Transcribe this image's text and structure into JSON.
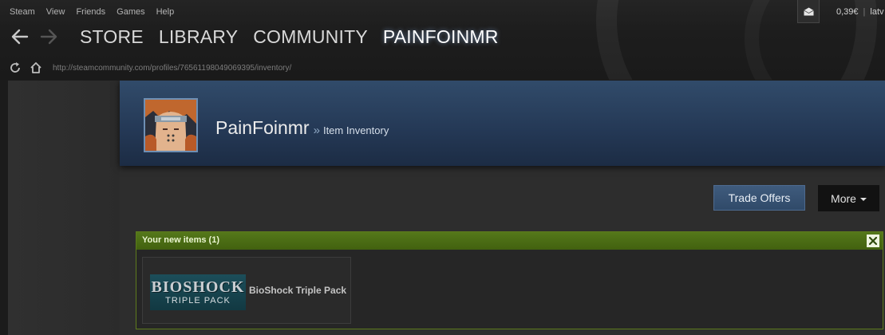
{
  "menubar": {
    "items": [
      "Steam",
      "View",
      "Friends",
      "Games",
      "Help"
    ]
  },
  "nav": {
    "tabs": [
      "STORE",
      "LIBRARY",
      "COMMUNITY",
      "PAINFOINMR"
    ],
    "active": "PAINFOINMR",
    "back_icon": "arrow-left-icon",
    "forward_icon": "arrow-right-icon"
  },
  "address": {
    "url": "http://steamcommunity.com/profiles/76561198049069395/inventory/",
    "refresh_icon": "refresh-icon",
    "home_icon": "home-icon"
  },
  "header_right": {
    "notification_icon": "envelope-icon",
    "wallet": "0,39€",
    "separator": "|",
    "language": "latv"
  },
  "profile": {
    "name": "PainFoinmr",
    "chevron": "»",
    "breadcrumb": "Item Inventory",
    "avatar_icon": "avatar-image"
  },
  "actions": {
    "trade_offers_label": "Trade Offers",
    "more_label": "More"
  },
  "new_items": {
    "title": "Your new items (1)",
    "close_icon": "close-icon",
    "items": [
      {
        "name": "BioShock Triple Pack",
        "logo_line1": "BIOSHOCK",
        "logo_line2": "TRIPLE PACK"
      }
    ]
  },
  "colors": {
    "profile_bar": "#2a405d",
    "new_items_header": "#4b6c15",
    "trade_offers_button": "#3a5576",
    "more_button": "#121212"
  }
}
